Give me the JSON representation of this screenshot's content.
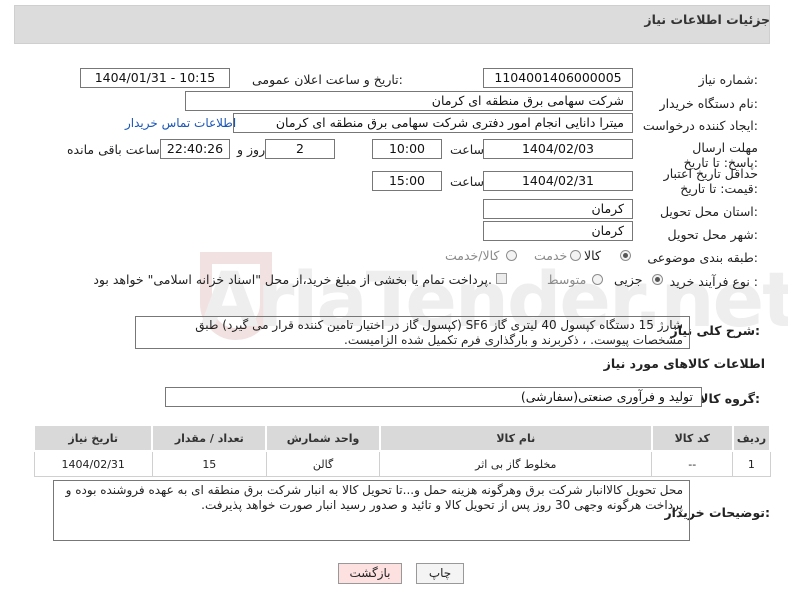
{
  "header": {
    "title": "جزئیات اطلاعات نیاز"
  },
  "form": {
    "need_number_label": "شماره نیاز:",
    "need_number": "1104001406000005",
    "announce_label": "تاریخ و ساعت اعلان عمومی:",
    "announce_value": "1404/01/31 - 10:15",
    "buyer_org_label": "نام دستگاه خریدار:",
    "buyer_org": "شرکت سهامی برق منطقه ای کرمان",
    "creator_label": "ایجاد کننده درخواست:",
    "creator": "میترا دانایی انجام امور دفتری شرکت سهامی برق منطقه ای کرمان",
    "contact_link": "اطلاعات تماس خریدار",
    "deadline_label": "مهلت ارسال پاسخ: تا تاریخ:",
    "deadline_date": "1404/02/03",
    "time_label": "ساعت",
    "deadline_time": "10:00",
    "days_value": "2",
    "days_label": "روز و",
    "remaining_time": "22:40:26",
    "remaining_label": "ساعت باقی مانده",
    "validity_label": "حداقل تاریخ اعتبار قیمت: تا تاریخ:",
    "validity_date": "1404/02/31",
    "validity_time_label": "ساعت",
    "validity_time": "15:00",
    "province_label": "استان محل تحویل:",
    "province": "کرمان",
    "city_label": "شهر محل تحویل:",
    "city": "کرمان",
    "category_label": "طبقه بندی موضوعی:",
    "category_options": [
      "کالا",
      "خدمت",
      "کالا/خدمت"
    ],
    "process_label": "نوع فرآیند خرید :",
    "process_options": [
      "جزیی",
      "متوسط"
    ],
    "payment_note": "پرداخت تمام یا بخشی از مبلغ خرید،از محل \"اسناد خزانه اسلامی\" خواهد بود."
  },
  "description": {
    "label": "شرح کلی نیاز:",
    "text": "شارژ 15 دستگاه کپسول 40 لیتری گاز SF6 (کپسول گاز در اختیار تامین کننده قرار می گیرد) طبق مشخصات پیوست. ، ذکربرند و بارگذاری فرم تکمیل شده الزامیست."
  },
  "goods": {
    "section_title": "اطلاعات کالاهای مورد نیاز",
    "group_label": "گروه کالا:",
    "group_value": "تولید و فرآوری صنعتی(سفارشی)",
    "columns": [
      "ردیف",
      "کد کالا",
      "نام کالا",
      "واحد شمارش",
      "تعداد / مقدار",
      "تاریخ نیاز"
    ],
    "rows": [
      {
        "row": "1",
        "code": "--",
        "name": "مخلوط گاز بی اثر",
        "unit": "گالن",
        "qty": "15",
        "date": "1404/02/31"
      }
    ]
  },
  "buyer_notes": {
    "label": "توضیحات خریدار:",
    "text": "محل تحویل کالاانبار شرکت برق وهرگونه هزینه حمل و...تا تحویل کالا به انبار شرکت برق منطقه ای به عهده فروشنده بوده و پرداخت هرگونه وجهی 30 روز پس از تحویل کالا و تائید و صدور رسید انبار صورت خواهد پذیرفت."
  },
  "buttons": {
    "print": "چاپ",
    "back": "بازگشت"
  },
  "watermark": "AriaTender.net"
}
